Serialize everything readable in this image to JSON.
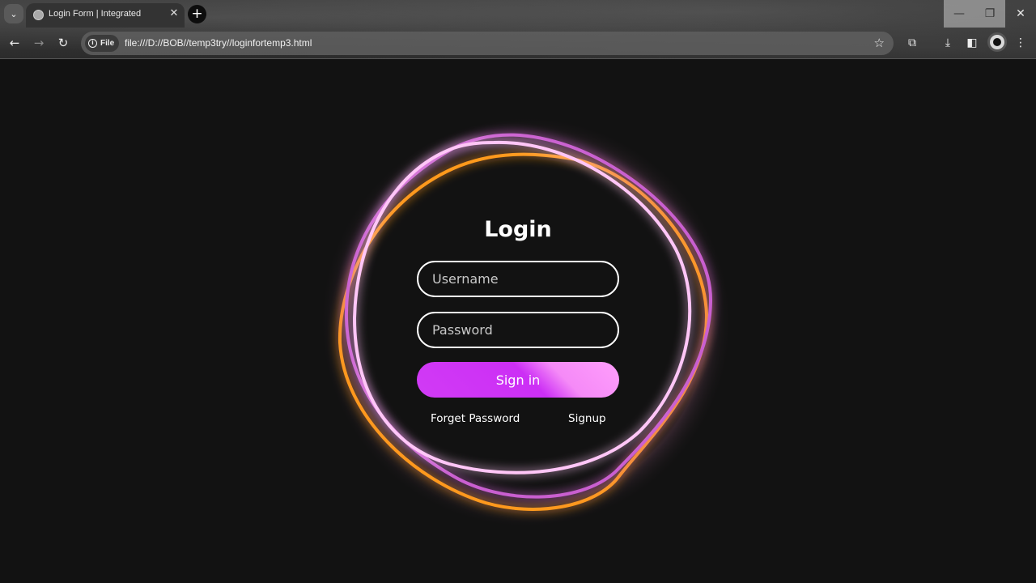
{
  "browser": {
    "tab_title": "Login Form | Integrated",
    "url": "file:///D://BOB//temp3try//loginfortemp3.html",
    "chip_label": "File"
  },
  "login": {
    "title": "Login",
    "username_placeholder": "Username",
    "password_placeholder": "Password",
    "signin_label": "Sign in",
    "forget_label": "Forget Password",
    "signup_label": "Signup"
  },
  "colors": {
    "ring_orange": "#ff9a1f",
    "ring_purple": "#c95fd0",
    "ring_pink": "#ffc6f7",
    "button_primary": "#cc2ff5",
    "button_highlight": "#ff9efc",
    "background": "#121212"
  }
}
